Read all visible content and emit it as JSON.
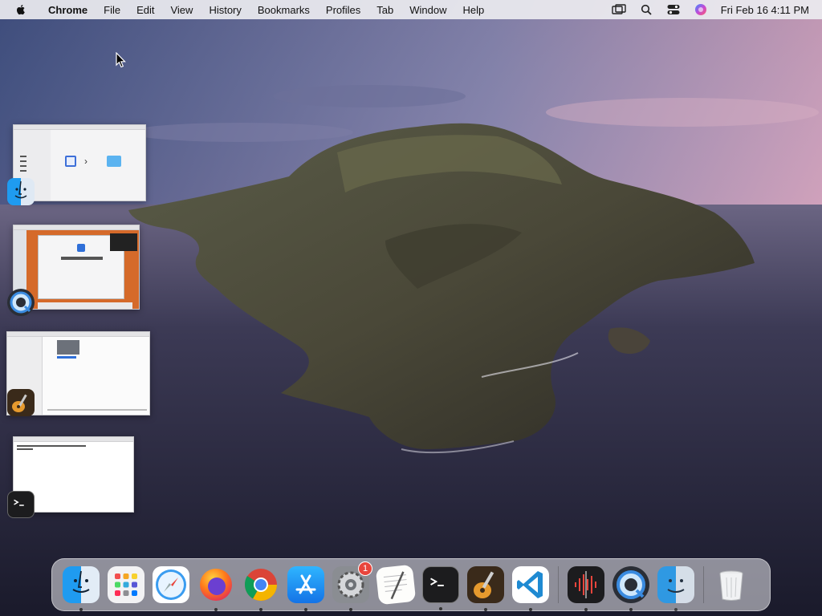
{
  "menubar": {
    "app_name": "Chrome",
    "menus": [
      "File",
      "Edit",
      "View",
      "History",
      "Bookmarks",
      "Profiles",
      "Tab",
      "Window",
      "Help"
    ],
    "status_icons": [
      "screen-mirroring-icon",
      "spotlight-search-icon",
      "control-center-icon",
      "siri-icon"
    ],
    "clock": "Fri Feb 16  4:11 PM"
  },
  "desktop": {
    "windows": [
      {
        "app": "Finder",
        "icon": "finder-icon"
      },
      {
        "app": "QuickTime Player",
        "icon": "quicktime-icon"
      },
      {
        "app": "GarageBand",
        "icon": "garageband-icon"
      },
      {
        "app": "Terminal",
        "icon": "terminal-icon"
      }
    ]
  },
  "dock": {
    "items": [
      {
        "name": "Finder",
        "icon": "finder-icon",
        "running": true
      },
      {
        "name": "Launchpad",
        "icon": "launchpad-icon",
        "running": false
      },
      {
        "name": "Safari",
        "icon": "safari-icon",
        "running": false
      },
      {
        "name": "Firefox",
        "icon": "firefox-icon",
        "running": true
      },
      {
        "name": "Google Chrome",
        "icon": "chrome-icon",
        "running": true
      },
      {
        "name": "App Store",
        "icon": "app-store-icon",
        "running": true
      },
      {
        "name": "System Preferences",
        "icon": "system-preferences-icon",
        "running": true,
        "badge": "1"
      },
      {
        "name": "TextEdit",
        "icon": "textedit-icon",
        "running": false
      },
      {
        "name": "Terminal",
        "icon": "terminal-icon",
        "running": true
      },
      {
        "name": "GarageBand",
        "icon": "garageband-icon",
        "running": true
      },
      {
        "name": "Visual Studio Code",
        "icon": "vscode-icon",
        "running": true
      },
      {
        "name": "Voice Memos",
        "icon": "voice-memos-icon",
        "running": true
      },
      {
        "name": "QuickTime Player",
        "icon": "quicktime-icon",
        "running": true
      },
      {
        "name": "Finder Downloads",
        "icon": "finder-stack-icon",
        "running": true
      },
      {
        "name": "Trash",
        "icon": "trash-icon",
        "running": false
      }
    ]
  },
  "colors": {
    "menubar_bg": "#ececf0",
    "badge_red": "#e8453c",
    "chrome_red": "#db4437",
    "chrome_green": "#0f9d58",
    "chrome_yellow": "#f4b400",
    "chrome_blue": "#4285f4"
  }
}
